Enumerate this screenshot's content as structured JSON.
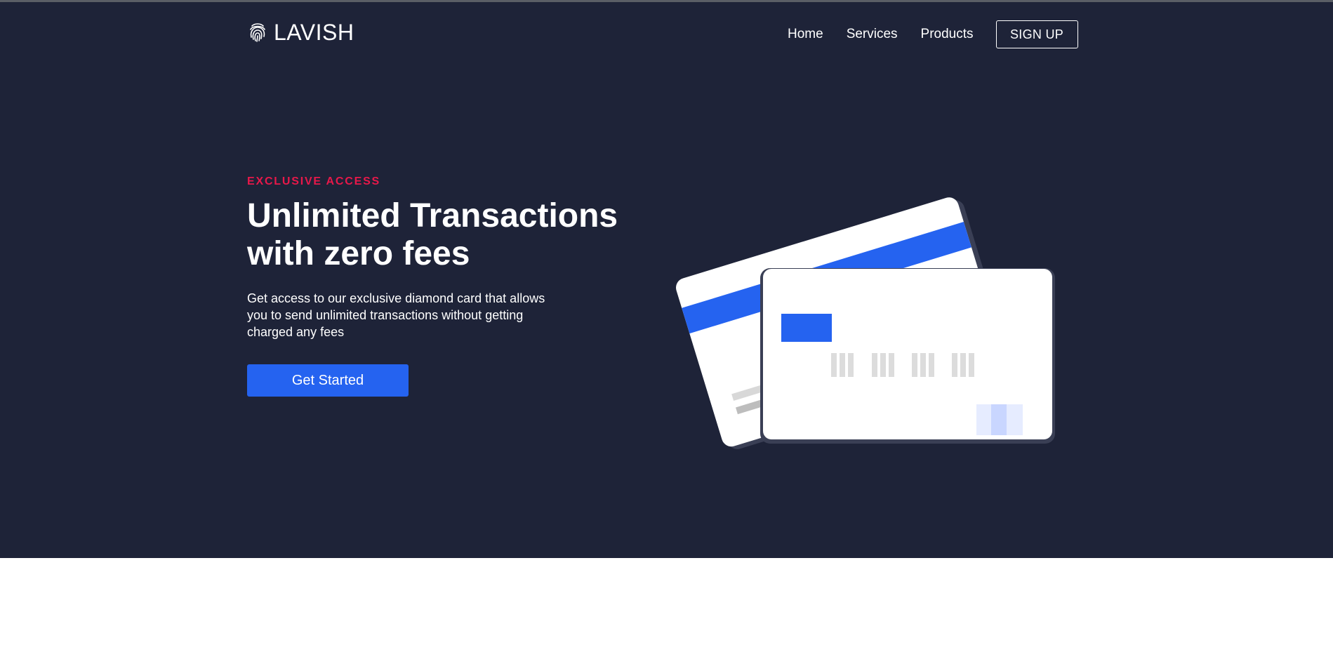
{
  "brand": {
    "name": "LAVISH",
    "icon": "fingerprint-icon"
  },
  "nav": {
    "items": [
      {
        "label": "Home"
      },
      {
        "label": "Services"
      },
      {
        "label": "Products"
      }
    ],
    "signup_label": "SIGN UP"
  },
  "hero": {
    "eyebrow": "EXCLUSIVE ACCESS",
    "headline_line1": "Unlimited Transactions",
    "headline_line2": "with zero fees",
    "description_line1": "Get access to our exclusive diamond card that allows",
    "description_line2": "you to send unlimited transactions without getting",
    "description_line3": "charged any fees",
    "cta_label": "Get Started"
  },
  "illustration": {
    "icon": "credit-cards-illustration"
  },
  "colors": {
    "background": "#1e2338",
    "accent_blue": "#2563f0",
    "eyebrow_red": "#e8184a",
    "text": "#ffffff"
  }
}
